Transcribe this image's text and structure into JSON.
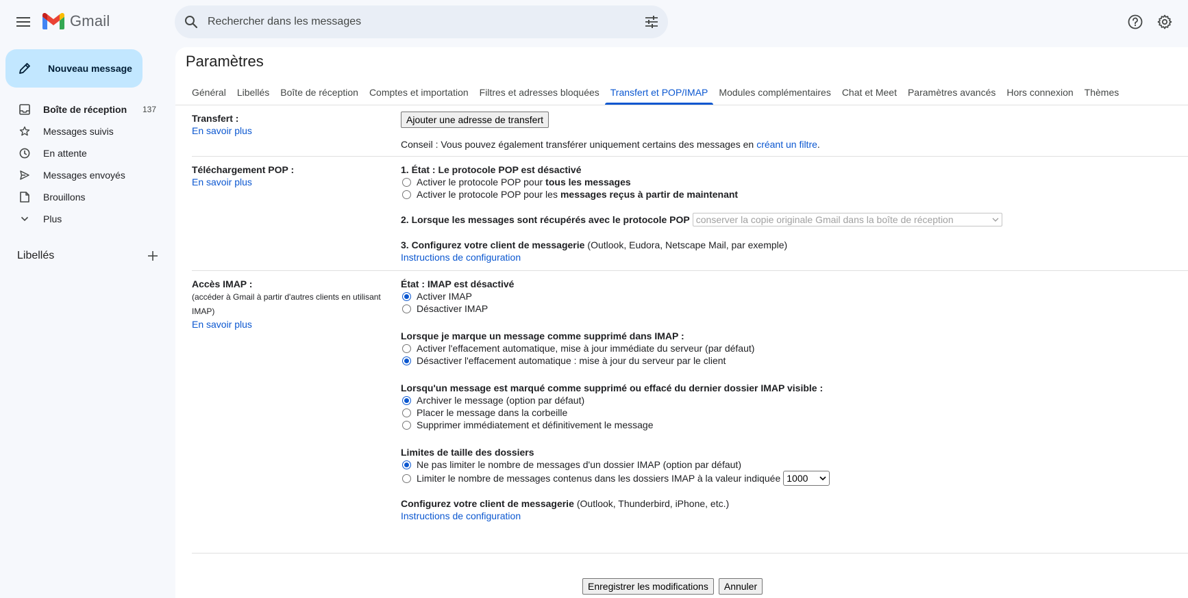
{
  "app": {
    "name": "Gmail"
  },
  "search": {
    "placeholder": "Rechercher dans les messages"
  },
  "sidebar": {
    "compose_label": "Nouveau message",
    "items": [
      {
        "label": "Boîte de réception",
        "count": "137",
        "icon": "inbox-icon"
      },
      {
        "label": "Messages suivis",
        "icon": "star-icon"
      },
      {
        "label": "En attente",
        "icon": "clock-icon"
      },
      {
        "label": "Messages envoyés",
        "icon": "send-icon"
      },
      {
        "label": "Brouillons",
        "icon": "draft-icon"
      },
      {
        "label": "Plus",
        "icon": "chevron-down-icon"
      }
    ],
    "labels_title": "Libellés"
  },
  "page": {
    "title": "Paramètres"
  },
  "tabs": [
    {
      "label": "Général"
    },
    {
      "label": "Libellés"
    },
    {
      "label": "Boîte de réception"
    },
    {
      "label": "Comptes et importation"
    },
    {
      "label": "Filtres et adresses bloquées"
    },
    {
      "label": "Transfert et POP/IMAP",
      "active": true
    },
    {
      "label": "Modules complémentaires"
    },
    {
      "label": "Chat et Meet"
    },
    {
      "label": "Paramètres avancés"
    },
    {
      "label": "Hors connexion"
    },
    {
      "label": "Thèmes"
    }
  ],
  "forwarding": {
    "title": "Transfert :",
    "learn_more": "En savoir plus",
    "add_button": "Ajouter une adresse de transfert",
    "tip_prefix": "Conseil : Vous pouvez également transférer uniquement certains des messages en ",
    "tip_link": "créant un filtre",
    "tip_suffix": "."
  },
  "pop": {
    "title": "Téléchargement POP :",
    "learn_more": "En savoir plus",
    "status": "1. État : Le protocole POP est désactivé",
    "opt1_prefix": "Activer le protocole POP pour ",
    "opt1_bold": "tous les messages",
    "opt2_prefix": "Activer le protocole POP pour les ",
    "opt2_bold": "messages reçus à partir de maintenant",
    "step2": "2. Lorsque les messages sont récupérés avec le protocole POP",
    "step2_select": "conserver la copie originale Gmail dans la boîte de réception",
    "step3_bold": "3. Configurez votre client de messagerie",
    "step3_rest": " (Outlook, Eudora, Netscape Mail, par exemple)",
    "config_link": "Instructions de configuration"
  },
  "imap": {
    "title": "Accès IMAP :",
    "sub": "(accéder à Gmail à partir d'autres clients en utilisant IMAP)",
    "learn_more": "En savoir plus",
    "status": "État : IMAP est désactivé",
    "enable": "Activer IMAP",
    "disable": "Désactiver IMAP",
    "deleted_title": "Lorsque je marque un message comme supprimé dans IMAP :",
    "deleted_opt1": "Activer l'effacement automatique, mise à jour immédiate du serveur (par défaut)",
    "deleted_opt2": "Désactiver l'effacement automatique : mise à jour du serveur par le client",
    "expunged_title": "Lorsqu'un message est marqué comme supprimé ou effacé du dernier dossier IMAP visible :",
    "expunged_opt1": "Archiver le message (option par défaut)",
    "expunged_opt2": "Placer le message dans la corbeille",
    "expunged_opt3": "Supprimer immédiatement et définitivement le message",
    "limits_title": "Limites de taille des dossiers",
    "limits_opt1": "Ne pas limiter le nombre de messages d'un dossier IMAP (option par défaut)",
    "limits_opt2": "Limiter le nombre de messages contenus dans les dossiers IMAP à la valeur indiquée",
    "limits_value": "1000",
    "client_bold": "Configurez votre client de messagerie",
    "client_rest": " (Outlook, Thunderbird, iPhone, etc.)",
    "config_link": "Instructions de configuration"
  },
  "footer": {
    "save": "Enregistrer les modifications",
    "cancel": "Annuler"
  },
  "colors": {
    "accent": "#0b57d0",
    "compose_bg": "#c2e7ff",
    "app_bg": "#f6f8fc"
  }
}
